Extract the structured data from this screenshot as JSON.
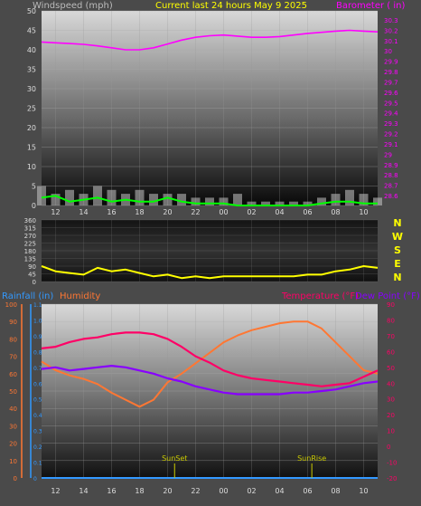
{
  "header": {
    "left": "Windspeed (mph)",
    "center": "Current last 24 hours May 9 2025",
    "right": "Barometer ( in)"
  },
  "lower_header": {
    "rainfall": "Rainfall (in)",
    "humidity": "Humidity",
    "temperature": "Temperature (°F)",
    "dewpoint": "Dew Point (°F)"
  },
  "compass_letters": [
    "N",
    "W",
    "S",
    "E",
    "N"
  ],
  "colors": {
    "windspeed": "#00ff00",
    "gust": "#c8c8c8",
    "barometer": "#ff00ff",
    "wind_direction": "#ffff00",
    "temperature": "#ff0066",
    "dewpoint": "#8800ff",
    "humidity": "#ff7733",
    "rainfall": "#3399ff",
    "sun_marker": "#cccc00",
    "title": "#ffff00"
  },
  "chart_data": [
    {
      "type": "line",
      "name": "wind-barometer",
      "x_tick_labels": [
        "12",
        "14",
        "16",
        "18",
        "20",
        "22",
        "00",
        "02",
        "04",
        "06",
        "08",
        "10"
      ],
      "y_left_ticks": [
        "0",
        "5",
        "10",
        "15",
        "20",
        "25",
        "30",
        "35",
        "40",
        "45",
        "50"
      ],
      "y_left_range": [
        0,
        50
      ],
      "y_right_ticks": [
        "29.6",
        "29.7",
        "29.8",
        "29.9",
        "29.8",
        "29.9",
        "30.0",
        "30.1",
        "30.2",
        "30.3",
        "30.4",
        "29.5",
        "29.6",
        "29.7",
        "29.8",
        "29.9",
        "30",
        "30.1",
        "30.2",
        "30.3"
      ],
      "y_right_labels_shown": [
        "29.6",
        "29.7",
        "29.8",
        "29.9",
        "30",
        "30.1",
        "30.2",
        "30.3",
        "30.4",
        "30.5",
        "30.6",
        "30.7",
        "30.8",
        "30.9",
        "31",
        "31.1"
      ],
      "x_hours": [
        11,
        12,
        13,
        14,
        15,
        16,
        17,
        18,
        19,
        20,
        21,
        22,
        23,
        24,
        25,
        26,
        27,
        28,
        29,
        30,
        31,
        32,
        33,
        34,
        35
      ],
      "barometer_left_units": [
        42,
        41.8,
        41.6,
        41.4,
        41,
        40.5,
        40,
        40,
        40.5,
        41.5,
        42.5,
        43.2,
        43.6,
        43.8,
        43.5,
        43.2,
        43.2,
        43.4,
        43.8,
        44.2,
        44.5,
        44.8,
        45,
        44.8,
        44.6
      ],
      "windspeed": [
        2,
        2.5,
        1,
        1.5,
        2,
        1,
        1.5,
        1,
        1,
        2,
        1,
        0.5,
        0.5,
        0.5,
        0,
        0,
        0,
        0,
        0,
        0,
        0.5,
        1,
        1,
        0.5,
        0.5
      ],
      "gust": [
        5,
        3,
        4,
        3,
        5,
        4,
        3,
        4,
        3,
        3,
        3,
        2,
        2,
        2,
        3,
        1,
        1,
        1,
        1,
        1,
        2,
        3,
        4,
        3,
        2
      ]
    },
    {
      "type": "scatter",
      "name": "wind-direction",
      "x_tick_labels": [
        "12",
        "14",
        "16",
        "18",
        "20",
        "22",
        "00",
        "02",
        "04",
        "06",
        "08",
        "10"
      ],
      "y_ticks": [
        "0",
        "45",
        "90",
        "135",
        "180",
        "225",
        "270",
        "315",
        "360"
      ],
      "y_range": [
        0,
        360
      ],
      "x_hours": [
        11,
        12,
        13,
        14,
        15,
        16,
        17,
        18,
        19,
        20,
        21,
        22,
        23,
        24,
        25,
        26,
        27,
        28,
        29,
        30,
        31,
        32,
        33,
        34,
        35
      ],
      "direction": [
        90,
        60,
        50,
        40,
        80,
        60,
        70,
        50,
        30,
        40,
        20,
        30,
        20,
        30,
        30,
        30,
        30,
        30,
        30,
        40,
        40,
        60,
        70,
        90,
        80
      ]
    },
    {
      "type": "line",
      "name": "temp-humidity",
      "x_tick_labels": [
        "12",
        "14",
        "16",
        "18",
        "20",
        "22",
        "00",
        "02",
        "04",
        "06",
        "08",
        "10"
      ],
      "y_left_ticks": [
        "0",
        "10",
        "20",
        "30",
        "40",
        "50",
        "60",
        "70",
        "80",
        "90",
        "100"
      ],
      "y_right_ticks": [
        "-20",
        "-15",
        "-10",
        "-5",
        "0",
        "5",
        "10",
        "15",
        "20",
        "25",
        "30",
        "35",
        "40",
        "45",
        "50",
        "55",
        "60",
        "65",
        "70",
        "75",
        "80",
        "85",
        "90"
      ],
      "y_right_range": [
        -20,
        90
      ],
      "rain_ticks": [
        "0",
        "0.1",
        "0.2",
        "0.3",
        "0.4",
        "0.5",
        "0.6",
        "0.7",
        "0.8",
        "0.9",
        "1.0",
        "1.1"
      ],
      "sunset_label": "SunSet",
      "sunrise_label": "SunRise",
      "sunset_hour": 20.5,
      "sunrise_hour": 30.3,
      "x_hours": [
        11,
        12,
        13,
        14,
        15,
        16,
        17,
        18,
        19,
        20,
        21,
        22,
        23,
        24,
        25,
        26,
        27,
        28,
        29,
        30,
        31,
        32,
        33,
        34,
        35
      ],
      "temperature": [
        62,
        63,
        66,
        68,
        69,
        71,
        72,
        72,
        71,
        68,
        63,
        57,
        53,
        48,
        45,
        43,
        42,
        41,
        40,
        39,
        38,
        39,
        40,
        44,
        48
      ],
      "dewpoint": [
        49,
        50,
        48,
        49,
        50,
        51,
        50,
        48,
        46,
        43,
        41,
        38,
        36,
        34,
        33,
        33,
        33,
        33,
        34,
        34,
        35,
        36,
        38,
        40,
        41
      ],
      "humidity": [
        67,
        62,
        59,
        57,
        54,
        49,
        45,
        41,
        45,
        55,
        60,
        66,
        72,
        78,
        82,
        85,
        87,
        89,
        90,
        90,
        86,
        78,
        70,
        62,
        60
      ]
    }
  ]
}
